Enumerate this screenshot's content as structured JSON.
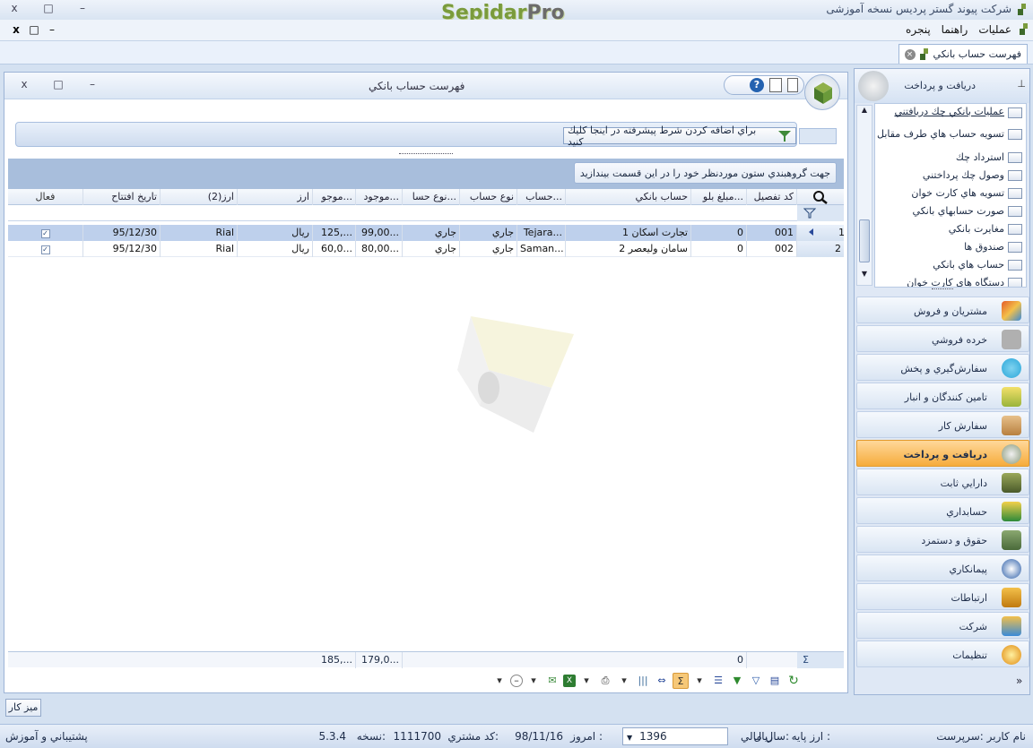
{
  "app": {
    "brand_main": "Sepidar",
    "brand_pro": "Pro",
    "company_title": "شرکت پیوند گستر پردیس نسخه آموزشی"
  },
  "window_buttons": {
    "close": "x",
    "restore": "□",
    "minimize": "–"
  },
  "menu": {
    "items": [
      "عملیات",
      "راهنما",
      "پنجره"
    ]
  },
  "doc_tab": {
    "label": "فهرست حساب بانکي"
  },
  "panel": {
    "title": "فهرست حساب بانکي"
  },
  "filter": {
    "button_label": "براي اضافه كردن شرط پيشرفته در اينجا كليك كنيد"
  },
  "group_hint": "جهت گروهبندي ستون موردنظر خود را در اين قسمت بيندازيد",
  "grid": {
    "columns": [
      "كد تفصيل",
      "مبلغ بلو...",
      "حساب بانكي",
      "حساب...",
      "نوع حساب",
      "نوع حسا...",
      "موجود...",
      "موجو...",
      "ارز",
      "ارز(2)",
      "تاريخ افتتاح",
      "فعال"
    ],
    "rows": [
      {
        "num": "1",
        "code": "001",
        "amount": "0",
        "bank_account": "تجارت اسكان 1",
        "account": "Tejara...",
        "type": "جاري",
        "type2": "جاري",
        "balance1": "99,00...",
        "balance2": "125,...",
        "currency": "ريال",
        "currency2": "Rial",
        "open_date": "95/12/30",
        "active": "✓"
      },
      {
        "num": "2",
        "code": "002",
        "amount": "0",
        "bank_account": "سامان وليعصر 2",
        "account": "Saman...",
        "type": "جاري",
        "type2": "جاري",
        "balance1": "80,00...",
        "balance2": "60,0...",
        "currency": "ريال",
        "currency2": "Rial",
        "open_date": "95/12/30",
        "active": "✓"
      }
    ],
    "footer": {
      "sigma": "Σ",
      "amount_total": "0",
      "balance1_total": "179,0...",
      "balance2_total": "185,..."
    }
  },
  "nav": {
    "header": "دریافت و پرداخت",
    "list_items": [
      "عمليات بانكي چك دريافتني",
      "تسويه حساب هاي طرف مقابل",
      "استرداد چك",
      "وصول چك پرداختني",
      "تسويه هاي كارت خوان",
      "صورت حسابهاي بانكي",
      "مغايرت بانكي",
      "صندوق ها",
      "حساب هاي بانكي",
      "دستگاه هاي كارت خوان"
    ],
    "modules": [
      {
        "label": "مشتريان و فروش",
        "color": "#e35b2a"
      },
      {
        "label": "خرده فروشي",
        "color": "#8a8a8a"
      },
      {
        "label": "سفارش‌گيري و پخش",
        "color": "#2aa6d9"
      },
      {
        "label": "تامين كنندگان و انبار",
        "color": "#c7b23a"
      },
      {
        "label": "سفارش كار",
        "color": "#c58a3c"
      },
      {
        "label": "دريافت و پرداخت",
        "color": "#6d8a5a"
      },
      {
        "label": "دارايي ثابت",
        "color": "#6b7f3a"
      },
      {
        "label": "حسابداري",
        "color": "#d9a21b"
      },
      {
        "label": "حقوق و دستمزد",
        "color": "#5a7a3a"
      },
      {
        "label": "پيمانكاري",
        "color": "#2a5da8"
      },
      {
        "label": "ارتباطات",
        "color": "#e0a020"
      },
      {
        "label": "شركت",
        "color": "#e0a020"
      },
      {
        "label": "تنظيمات",
        "color": "#e08a10"
      }
    ],
    "active_module": "دريافت و پرداخت",
    "expand": "»"
  },
  "desk": {
    "label": "ميز كار"
  },
  "status": {
    "user": "نام كاربر :سرپرست",
    "base_currency_label": "ارز پايه :",
    "base_currency": "ريال",
    "fiscal_year_label": "سال مالي:",
    "fiscal_year": "1396",
    "today_label": "امروز :",
    "today": "98/11/16",
    "customer_code_label": "كد مشتري:",
    "customer_code": "1111700",
    "version_label": "نسخه:",
    "version": "5.3.4",
    "support": "پشتيباني و آموزش"
  },
  "colors": {
    "accent": "#f6ac3c",
    "selection": "#bed0ec",
    "chrome": "#d4e1f1"
  }
}
